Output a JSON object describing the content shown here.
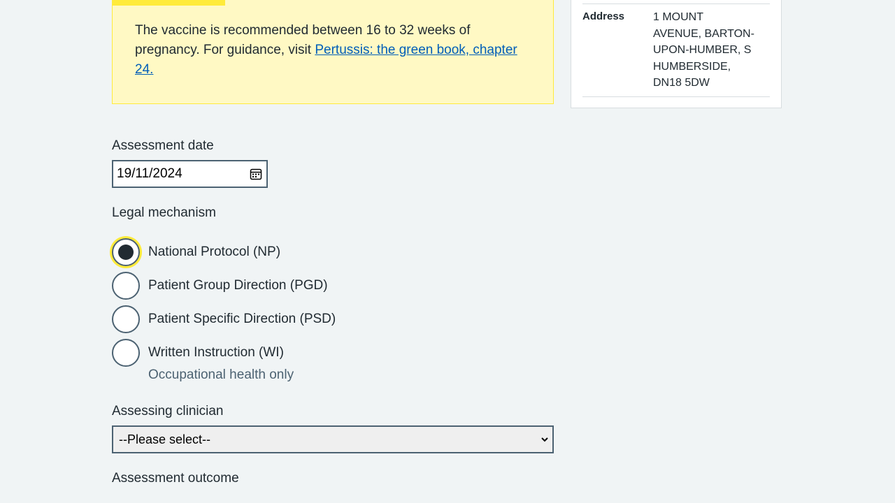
{
  "callout": {
    "text": "The vaccine is recommended between 16 to 32 weeks of pregnancy. For guidance, visit ",
    "link_text": "Pertussis: the green book, chapter 24."
  },
  "assessment_date": {
    "label": "Assessment date",
    "value": "19/11/2024"
  },
  "legal_mechanism": {
    "label": "Legal mechanism",
    "options": [
      {
        "label": "National Protocol (NP)",
        "checked": true
      },
      {
        "label": "Patient Group Direction (PGD)",
        "checked": false
      },
      {
        "label": "Patient Specific Direction (PSD)",
        "checked": false
      },
      {
        "label": "Written Instruction (WI)",
        "checked": false,
        "hint": "Occupational health only"
      }
    ]
  },
  "assessing_clinician": {
    "label": "Assessing clinician",
    "selected": "--Please select--"
  },
  "assessment_outcome": {
    "label": "Assessment outcome"
  },
  "patient_summary": {
    "address_key": "Address",
    "address_lines": [
      "1 MOUNT",
      "AVENUE, BARTON-",
      "UPON-HUMBER, S",
      "HUMBERSIDE,",
      "DN18 5DW"
    ]
  },
  "colors": {
    "background": "#f0f4f5",
    "warning_bg": "#fff9c4",
    "focus_yellow": "#ffeb3b",
    "link_blue": "#005eb8",
    "border_grey": "#4c6272"
  }
}
